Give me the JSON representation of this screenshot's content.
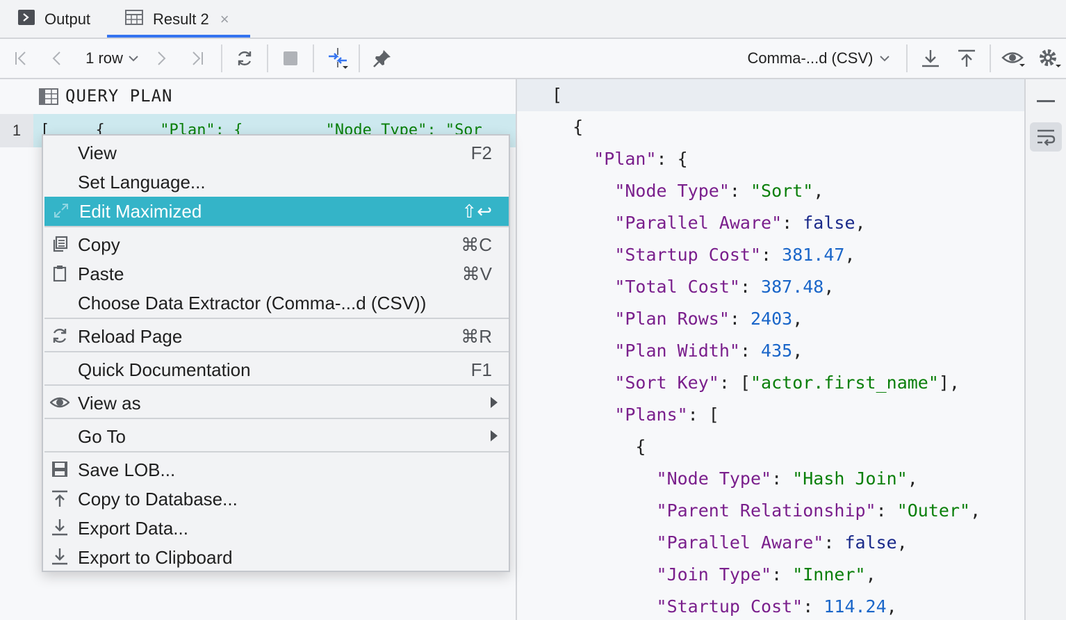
{
  "tabs": {
    "output_label": "Output",
    "result_label": "Result 2",
    "close_glyph": "×"
  },
  "toolbar": {
    "rows_label": "1 row",
    "extractor_label": "Comma-...d (CSV)",
    "icons": [
      "first-page-icon",
      "prev-page-icon",
      "next-page-icon",
      "last-page-icon",
      "reload-icon",
      "stop-icon",
      "compare-icon",
      "pin-icon",
      "download-icon",
      "upload-icon",
      "eye-icon",
      "gear-icon"
    ]
  },
  "grid": {
    "column_header": "QUERY PLAN",
    "row_number": "1",
    "cell_preview": [
      {
        "t": "[ ",
        "c": "b"
      },
      {
        "t": "    { ",
        "c": "b"
      },
      {
        "t": "     \"Plan\": { ",
        "c": "s"
      },
      {
        "t": "        \"Node Type\": \"Sor",
        "c": "s"
      }
    ]
  },
  "context_menu": {
    "items": [
      {
        "label": "View",
        "shortcut": "F2",
        "icon": "",
        "submenu": false
      },
      {
        "label": "Set Language...",
        "shortcut": "",
        "icon": "",
        "submenu": false
      },
      {
        "label": "Edit Maximized",
        "shortcut": "⇧↩",
        "icon": "maximize-icon",
        "submenu": false,
        "active": true
      },
      {
        "label": "Copy",
        "shortcut": "⌘C",
        "icon": "copy-icon",
        "submenu": false
      },
      {
        "label": "Paste",
        "shortcut": "⌘V",
        "icon": "paste-icon",
        "submenu": false
      },
      {
        "label": "Choose Data Extractor (Comma-...d (CSV))",
        "shortcut": "",
        "icon": "",
        "submenu": false
      },
      {
        "label": "Reload Page",
        "shortcut": "⌘R",
        "icon": "reload-icon",
        "submenu": false
      },
      {
        "label": "Quick Documentation",
        "shortcut": "F1",
        "icon": "",
        "submenu": false
      },
      {
        "label": "View as",
        "shortcut": "",
        "icon": "eye-icon",
        "submenu": true
      },
      {
        "label": "Go To",
        "shortcut": "",
        "icon": "",
        "submenu": true
      },
      {
        "label": "Save LOB...",
        "shortcut": "",
        "icon": "save-icon",
        "submenu": false
      },
      {
        "label": "Copy to Database...",
        "shortcut": "",
        "icon": "upload-icon",
        "submenu": false
      },
      {
        "label": "Export Data...",
        "shortcut": "",
        "icon": "download-icon",
        "submenu": false
      },
      {
        "label": "Export to Clipboard",
        "shortcut": "",
        "icon": "download-icon",
        "submenu": false
      }
    ]
  },
  "viewer": {
    "lines": [
      [
        {
          "t": "[",
          "c": "p"
        }
      ],
      [
        {
          "t": "  {",
          "c": "p"
        }
      ],
      [
        {
          "t": "    ",
          "c": "p"
        },
        {
          "t": "\"Plan\"",
          "c": "k"
        },
        {
          "t": ": {",
          "c": "p"
        }
      ],
      [
        {
          "t": "      ",
          "c": "p"
        },
        {
          "t": "\"Node Type\"",
          "c": "k"
        },
        {
          "t": ": ",
          "c": "p"
        },
        {
          "t": "\"Sort\"",
          "c": "s"
        },
        {
          "t": ",",
          "c": "p"
        }
      ],
      [
        {
          "t": "      ",
          "c": "p"
        },
        {
          "t": "\"Parallel Aware\"",
          "c": "k"
        },
        {
          "t": ": ",
          "c": "p"
        },
        {
          "t": "false",
          "c": "kw"
        },
        {
          "t": ",",
          "c": "p"
        }
      ],
      [
        {
          "t": "      ",
          "c": "p"
        },
        {
          "t": "\"Startup Cost\"",
          "c": "k"
        },
        {
          "t": ": ",
          "c": "p"
        },
        {
          "t": "381.47",
          "c": "n"
        },
        {
          "t": ",",
          "c": "p"
        }
      ],
      [
        {
          "t": "      ",
          "c": "p"
        },
        {
          "t": "\"Total Cost\"",
          "c": "k"
        },
        {
          "t": ": ",
          "c": "p"
        },
        {
          "t": "387.48",
          "c": "n"
        },
        {
          "t": ",",
          "c": "p"
        }
      ],
      [
        {
          "t": "      ",
          "c": "p"
        },
        {
          "t": "\"Plan Rows\"",
          "c": "k"
        },
        {
          "t": ": ",
          "c": "p"
        },
        {
          "t": "2403",
          "c": "n"
        },
        {
          "t": ",",
          "c": "p"
        }
      ],
      [
        {
          "t": "      ",
          "c": "p"
        },
        {
          "t": "\"Plan Width\"",
          "c": "k"
        },
        {
          "t": ": ",
          "c": "p"
        },
        {
          "t": "435",
          "c": "n"
        },
        {
          "t": ",",
          "c": "p"
        }
      ],
      [
        {
          "t": "      ",
          "c": "p"
        },
        {
          "t": "\"Sort Key\"",
          "c": "k"
        },
        {
          "t": ": [",
          "c": "p"
        },
        {
          "t": "\"actor.first_name\"",
          "c": "s"
        },
        {
          "t": "],",
          "c": "p"
        }
      ],
      [
        {
          "t": "      ",
          "c": "p"
        },
        {
          "t": "\"Plans\"",
          "c": "k"
        },
        {
          "t": ": [",
          "c": "p"
        }
      ],
      [
        {
          "t": "        {",
          "c": "p"
        }
      ],
      [
        {
          "t": "          ",
          "c": "p"
        },
        {
          "t": "\"Node Type\"",
          "c": "k"
        },
        {
          "t": ": ",
          "c": "p"
        },
        {
          "t": "\"Hash Join\"",
          "c": "s"
        },
        {
          "t": ",",
          "c": "p"
        }
      ],
      [
        {
          "t": "          ",
          "c": "p"
        },
        {
          "t": "\"Parent Relationship\"",
          "c": "k"
        },
        {
          "t": ": ",
          "c": "p"
        },
        {
          "t": "\"Outer\"",
          "c": "s"
        },
        {
          "t": ",",
          "c": "p"
        }
      ],
      [
        {
          "t": "          ",
          "c": "p"
        },
        {
          "t": "\"Parallel Aware\"",
          "c": "k"
        },
        {
          "t": ": ",
          "c": "p"
        },
        {
          "t": "false",
          "c": "kw"
        },
        {
          "t": ",",
          "c": "p"
        }
      ],
      [
        {
          "t": "          ",
          "c": "p"
        },
        {
          "t": "\"Join Type\"",
          "c": "k"
        },
        {
          "t": ": ",
          "c": "p"
        },
        {
          "t": "\"Inner\"",
          "c": "s"
        },
        {
          "t": ",",
          "c": "p"
        }
      ],
      [
        {
          "t": "          ",
          "c": "p"
        },
        {
          "t": "\"Startup Cost\"",
          "c": "k"
        },
        {
          "t": ": ",
          "c": "p"
        },
        {
          "t": "114.24",
          "c": "n"
        },
        {
          "t": ",",
          "c": "p"
        }
      ]
    ]
  },
  "colors": {
    "accent": "#3574f0",
    "menu_highlight": "#34b4c8",
    "json_key": "#7a1f8c",
    "json_string": "#0a7f0a",
    "json_number": "#1a66c9",
    "json_keyword": "#1a2a8a"
  }
}
